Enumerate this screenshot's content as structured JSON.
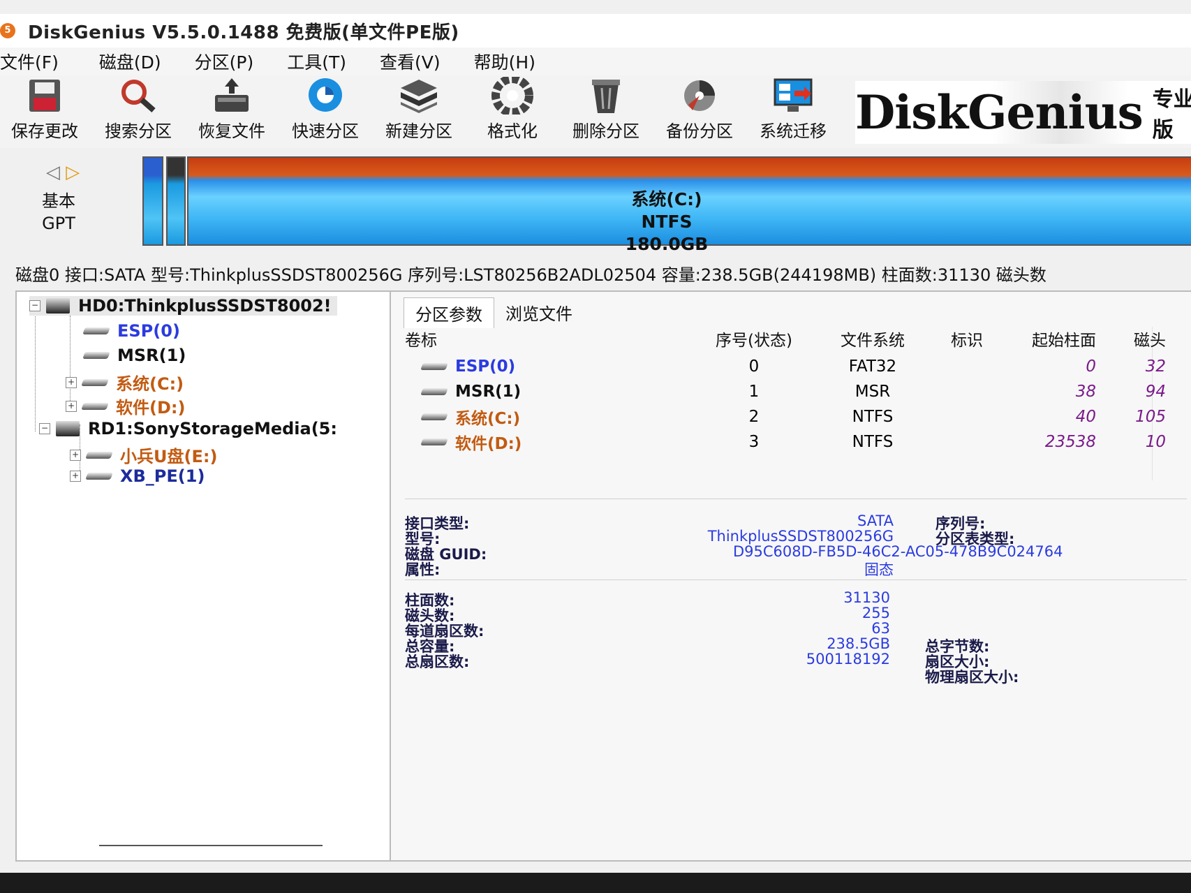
{
  "title": "DiskGenius V5.5.0.1488 免费版(单文件PE版)",
  "menu": [
    "文件(F)",
    "磁盘(D)",
    "分区(P)",
    "工具(T)",
    "查看(V)",
    "帮助(H)"
  ],
  "toolbar": [
    {
      "label": "保存更改",
      "icon": "save-icon"
    },
    {
      "label": "搜索分区",
      "icon": "search-icon"
    },
    {
      "label": "恢复文件",
      "icon": "recover-icon"
    },
    {
      "label": "快速分区",
      "icon": "quick-partition-icon"
    },
    {
      "label": "新建分区",
      "icon": "new-partition-icon"
    },
    {
      "label": "格式化",
      "icon": "format-icon"
    },
    {
      "label": "删除分区",
      "icon": "delete-icon"
    },
    {
      "label": "备份分区",
      "icon": "backup-icon"
    },
    {
      "label": "系统迁移",
      "icon": "migrate-icon"
    }
  ],
  "brand": {
    "name": "DiskGenius",
    "edition": "专业版"
  },
  "diskmap": {
    "type_line1": "基本",
    "type_line2": "GPT",
    "partition_name": "系统(C:)",
    "partition_fs": "NTFS",
    "partition_size": "180.0GB"
  },
  "disk_info_line": "磁盘0 接口:SATA  型号:ThinkplusSSDST800256G  序列号:LST80256B2ADL02504  容量:238.5GB(244198MB)  柱面数:31130  磁头数",
  "tree": {
    "disk0": "HD0:ThinkplusSSDST8002!",
    "disk0_parts": [
      "ESP(0)",
      "MSR(1)",
      "系统(C:)",
      "软件(D:)"
    ],
    "disk1": "RD1:SonyStorageMedia(5:",
    "disk1_parts": [
      "小兵U盘(E:)",
      "XB_PE(1)"
    ]
  },
  "tabs": [
    "分区参数",
    "浏览文件"
  ],
  "table": {
    "headers": [
      "卷标",
      "序号(状态)",
      "文件系统",
      "标识",
      "起始柱面",
      "磁头"
    ],
    "rows": [
      {
        "vol": "ESP(0)",
        "idx": "0",
        "fs": "FAT32",
        "cyl": "0",
        "head": "32"
      },
      {
        "vol": "MSR(1)",
        "idx": "1",
        "fs": "MSR",
        "cyl": "38",
        "head": "94"
      },
      {
        "vol": "系统(C:)",
        "idx": "2",
        "fs": "NTFS",
        "cyl": "40",
        "head": "105"
      },
      {
        "vol": "软件(D:)",
        "idx": "3",
        "fs": "NTFS",
        "cyl": "23538",
        "head": "10"
      }
    ]
  },
  "info": {
    "iface_label": "接口类型:",
    "iface_val": "SATA",
    "model_label": "型号:",
    "model_val": "ThinkplusSSDST800256G",
    "guid_label": "磁盘 GUID:",
    "guid_val": "D95C608D-FB5D-46C2-AC05-478B9C024764",
    "attr_label": "属性:",
    "attr_val": "固态",
    "serial_label": "序列号:",
    "ptype_label": "分区表类型:",
    "cyl_label": "柱面数:",
    "cyl_val": "31130",
    "heads_label": "磁头数:",
    "heads_val": "255",
    "spt_label": "每道扇区数:",
    "spt_val": "63",
    "cap_label": "总容量:",
    "cap_val": "238.5GB",
    "sectors_label": "总扇区数:",
    "sectors_val": "500118192",
    "bytes_label": "总字节数:",
    "secsize_label": "扇区大小:",
    "physsec_label": "物理扇区大小:"
  }
}
